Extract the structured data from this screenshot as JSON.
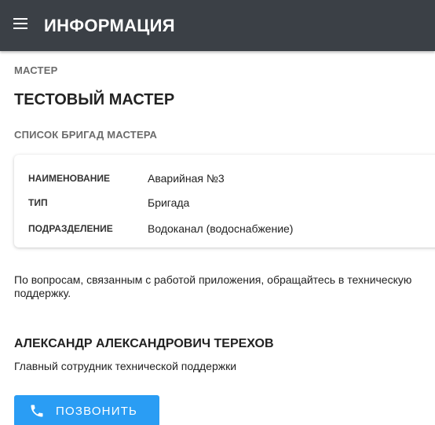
{
  "header": {
    "menu_icon": "hamburger-menu-icon",
    "title": "ИНФОРМАЦИЯ",
    "background_color": "#3b4046"
  },
  "master": {
    "section_label": "МАСТЕР",
    "name": "ТЕСТОВЫЙ МАСТЕР"
  },
  "brigades": {
    "section_label": "СПИСОК БРИГАД МАСТЕРА",
    "items": [
      {
        "rows": [
          {
            "key": "НАИМЕНОВАНИЕ",
            "value": "Аварийная №3"
          },
          {
            "key": "ТИП",
            "value": "Бригада"
          },
          {
            "key": "ПОДРАЗДЕЛЕНИЕ",
            "value": "Водоканал (водоснабжение)"
          }
        ]
      }
    ]
  },
  "support": {
    "note": "По вопросам, связанным с работой приложения, обращайтесь в техническую поддержку.",
    "contact_name": "АЛЕКСАНДР АЛЕКСАНДРОВИЧ ТЕРЕХОВ",
    "contact_role": "Главный сотрудник технической поддержки",
    "call_button": {
      "label": "ПОЗВОНИТЬ",
      "icon": "phone-icon",
      "color": "#2a9df4"
    }
  }
}
